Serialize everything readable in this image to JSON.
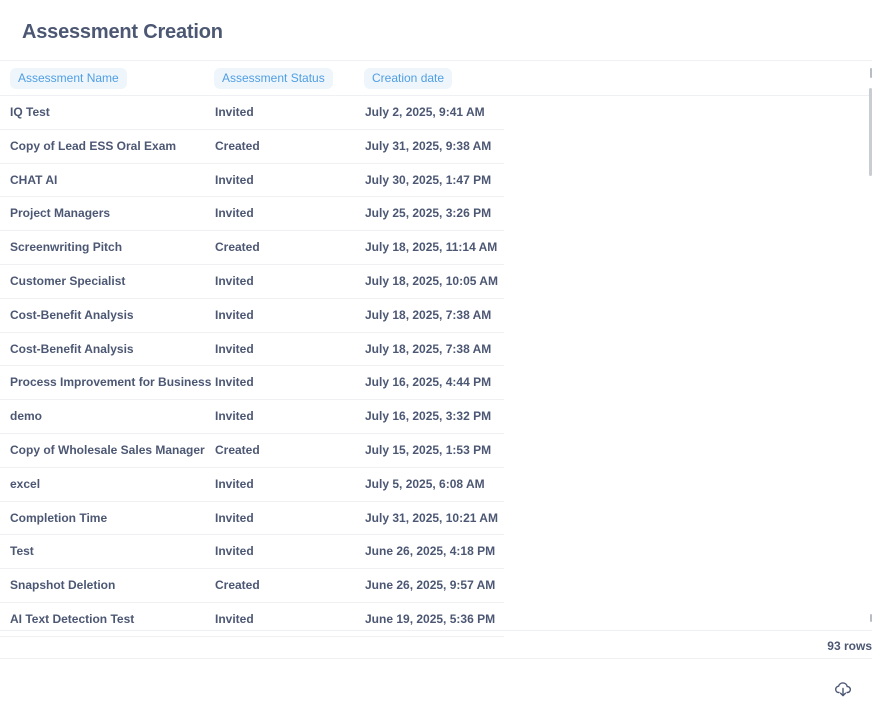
{
  "page": {
    "title": "Assessment Creation"
  },
  "table": {
    "columns": [
      "Assessment Name",
      "Assessment Status",
      "Creation date"
    ],
    "rows": [
      {
        "name": "IQ Test",
        "status": "Invited",
        "date": "July 2, 2025, 9:41 AM"
      },
      {
        "name": "Copy of Lead ESS Oral Exam",
        "status": "Created",
        "date": "July 31, 2025, 9:38 AM"
      },
      {
        "name": "CHAT AI",
        "status": "Invited",
        "date": "July 30, 2025, 1:47 PM"
      },
      {
        "name": "Project Managers",
        "status": "Invited",
        "date": "July 25, 2025, 3:26 PM"
      },
      {
        "name": "Screenwriting Pitch",
        "status": "Created",
        "date": "July 18, 2025, 11:14 AM"
      },
      {
        "name": "Customer Specialist",
        "status": "Invited",
        "date": "July 18, 2025, 10:05 AM"
      },
      {
        "name": "Cost-Benefit Analysis",
        "status": "Invited",
        "date": "July 18, 2025, 7:38 AM"
      },
      {
        "name": "Cost-Benefit Analysis",
        "status": "Invited",
        "date": "July 18, 2025, 7:38 AM"
      },
      {
        "name": "Process Improvement for Business",
        "status": "Invited",
        "date": "July 16, 2025, 4:44 PM"
      },
      {
        "name": "demo",
        "status": "Invited",
        "date": "July 16, 2025, 3:32 PM"
      },
      {
        "name": "Copy of Wholesale Sales Manager",
        "status": "Created",
        "date": "July 15, 2025, 1:53 PM"
      },
      {
        "name": "excel",
        "status": "Invited",
        "date": "July 5, 2025, 6:08 AM"
      },
      {
        "name": "Completion Time",
        "status": "Invited",
        "date": "July 31, 2025, 10:21 AM"
      },
      {
        "name": "Test",
        "status": "Invited",
        "date": "June 26, 2025, 4:18 PM"
      },
      {
        "name": "Snapshot Deletion",
        "status": "Created",
        "date": "June 26, 2025, 9:57 AM"
      },
      {
        "name": "AI Text Detection Test",
        "status": "Invited",
        "date": "June 19, 2025, 5:36 PM"
      }
    ]
  },
  "footer": {
    "row_count": "93 rows",
    "download_icon": "cloud-download-icon"
  },
  "colors": {
    "accent": "#509ee3",
    "text": "#4c5773",
    "pill_bg": "#eef6fc"
  }
}
